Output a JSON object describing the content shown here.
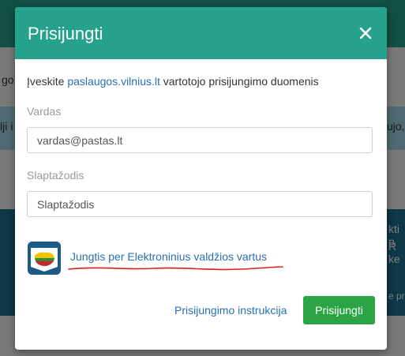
{
  "background": {
    "fragments": [
      "go",
      "lji i",
      "ujo,",
      "kti p",
      "R ke",
      "e pr"
    ]
  },
  "modal": {
    "title": "Prisijungti",
    "close_icon": "close-icon",
    "intro_prefix": "Įveskite ",
    "intro_link": "paslaugos.vilnius.lt",
    "intro_suffix": " vartotojo prisijungimo duomenis",
    "username": {
      "label": "Vardas",
      "value": "vardas@pastas.lt"
    },
    "password": {
      "label": "Slaptažodis",
      "placeholder": "Slaptažodis"
    },
    "egov_link": "Jungtis per Elektroninius valdžios vartus",
    "instructions_link": "Prisijungimo instrukcija",
    "login_button": "Prisijungti"
  },
  "colors": {
    "header": "#26a18c",
    "link": "#2a6fb0",
    "primary_button": "#2aa445",
    "annotation": "#e0201a"
  }
}
